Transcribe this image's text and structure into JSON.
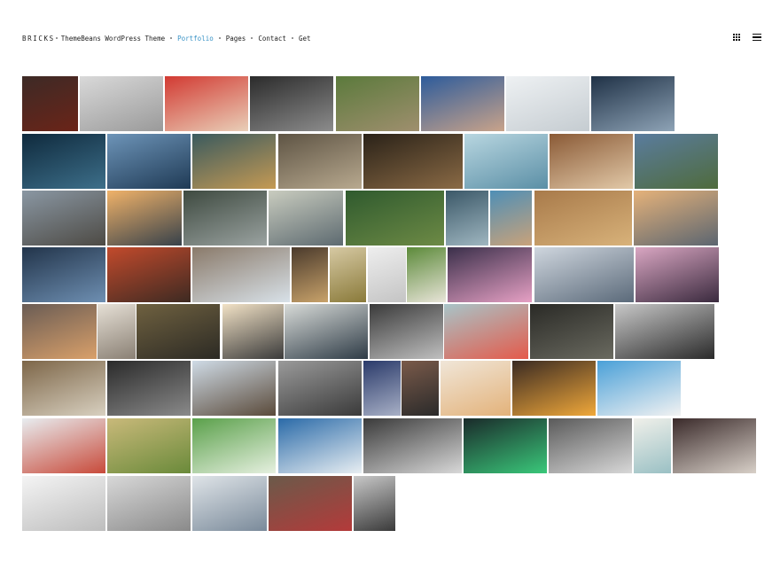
{
  "header": {
    "brand": "BRICKS",
    "nav": [
      {
        "label": "ThemeBeans WordPress Theme",
        "active": false
      },
      {
        "label": "Portfolio",
        "active": true
      },
      {
        "label": "Pages",
        "active": false
      },
      {
        "label": "Contact",
        "active": false
      },
      {
        "label": "Get",
        "active": false
      }
    ],
    "view_icons": [
      "grid-icon",
      "list-icon"
    ],
    "accent_color": "#3a93c6"
  },
  "portfolio": {
    "item_count": 62
  }
}
